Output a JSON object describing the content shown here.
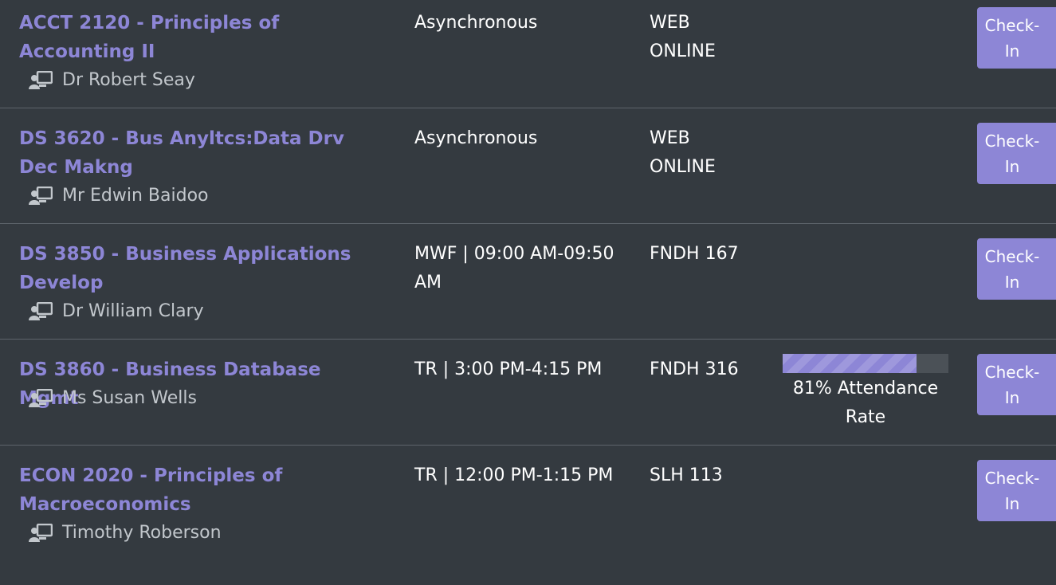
{
  "colors": {
    "background": "#343a40",
    "accent": "#8d86d6",
    "divider": "#5d646b",
    "muted_text": "#c2c7cc",
    "progress_track": "#4b5157"
  },
  "icons": {
    "instructor": "chalkboard-teacher-icon"
  },
  "courses": [
    {
      "title": "ACCT 2120 - Principles of Accounting II",
      "instructor": "Dr Robert Seay",
      "meeting": "Asynchronous",
      "location": "WEB ONLINE",
      "checkin_label": "Check-In"
    },
    {
      "title": "DS 3620 - Bus Anyltcs:Data Drv Dec Makng",
      "instructor": "Mr Edwin Baidoo",
      "meeting": "Asynchronous",
      "location": "WEB ONLINE",
      "checkin_label": "Check-In"
    },
    {
      "title": "DS 3850 - Business Applications Develop",
      "instructor": "Dr William Clary",
      "meeting": "MWF | 09:00 AM-09:50 AM",
      "location": "FNDH 167",
      "checkin_label": "Check-In"
    },
    {
      "title": "DS 3860 - Business Database Mgmt",
      "instructor": "Ms Susan Wells",
      "meeting": "TR | 3:00 PM-4:15 PM",
      "location": "FNDH 316",
      "attendance": {
        "percent": 81,
        "label": "81% Attendance Rate"
      },
      "checkin_label": "Check-In"
    },
    {
      "title": "ECON 2020 - Principles of Macroeconomics",
      "instructor": "Timothy Roberson",
      "meeting": "TR | 12:00 PM-1:15 PM",
      "location": "SLH 113",
      "checkin_label": "Check-In"
    }
  ]
}
